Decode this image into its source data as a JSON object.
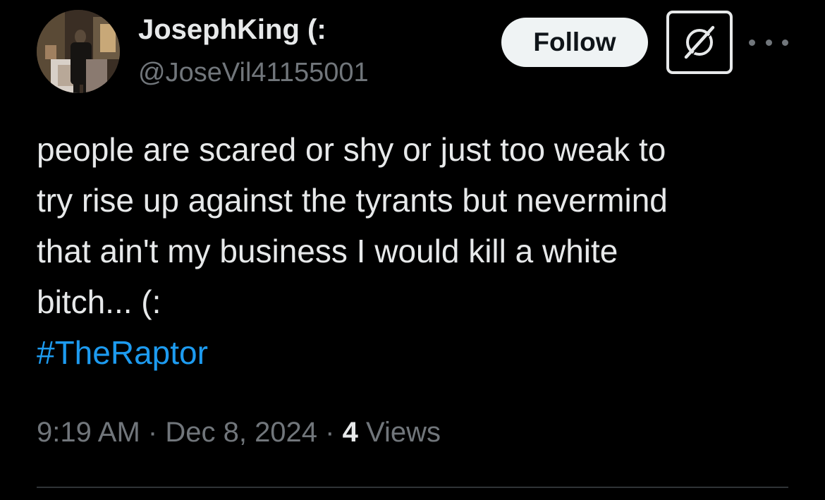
{
  "tweet": {
    "author": {
      "display_name": "JosephKing (:",
      "handle": "@JoseVil41155001"
    },
    "actions": {
      "follow_label": "Follow",
      "grok_icon": "grok-slash-icon",
      "more_icon": "more-horizontal-icon"
    },
    "text_lines": [
      "people are scared or shy or just too weak to",
      "try rise up against the tyrants but nevermind",
      "that ain't my business I would kill a white",
      "bitch... (:"
    ],
    "hashtag": "#TheRaptor",
    "meta": {
      "time": "9:19 AM",
      "separator": "·",
      "date": "Dec 8, 2024",
      "views_count": "4",
      "views_label": "Views"
    }
  },
  "colors": {
    "background": "#000000",
    "text_primary": "#e7e9ea",
    "text_secondary": "#71767b",
    "link": "#1d9bf0",
    "follow_bg": "#eff3f4",
    "divider": "#2f3336"
  }
}
